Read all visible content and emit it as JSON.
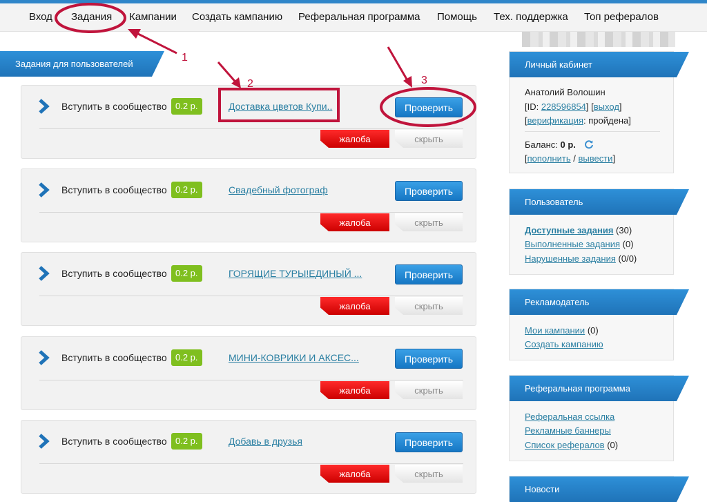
{
  "nav": {
    "items": [
      "Вход",
      "Задания",
      "Кампании",
      "Создать кампанию",
      "Реферальная программа",
      "Помощь",
      "Тех. поддержка",
      "Топ рефералов"
    ]
  },
  "main": {
    "section_title": "Задания для пользователей",
    "tasks": [
      {
        "title": "Вступить в сообщество",
        "price": "0.2 р.",
        "link": "Доставка цветов Купи..",
        "check": "Проверить",
        "complain": "жалоба",
        "hide": "скрыть"
      },
      {
        "title": "Вступить в сообщество",
        "price": "0.2 р.",
        "link": "Свадебный фотограф",
        "check": "Проверить",
        "complain": "жалоба",
        "hide": "скрыть"
      },
      {
        "title": "Вступить в сообщество",
        "price": "0.2 р.",
        "link": "ГОРЯЩИЕ ТУРЫ!ЕДИНЫЙ ...",
        "check": "Проверить",
        "complain": "жалоба",
        "hide": "скрыть"
      },
      {
        "title": "Вступить в сообщество",
        "price": "0.2 р.",
        "link": "МИНИ-КОВРИКИ И АКСЕС...",
        "check": "Проверить",
        "complain": "жалоба",
        "hide": "скрыть"
      },
      {
        "title": "Вступить в сообщество",
        "price": "0.2 р.",
        "link": "Добавь в друзья",
        "check": "Проверить",
        "complain": "жалоба",
        "hide": "скрыть"
      }
    ]
  },
  "sidebar": {
    "cabinet": {
      "title": "Личный кабинет",
      "name": "Анатолий Волошин",
      "id_prefix": "[ID: ",
      "id_value": "228596854",
      "id_mid": "] [",
      "logout": "выход",
      "id_suffix": "]",
      "verif_open": "[",
      "verif_link": "верификация",
      "verif_status": ": пройдена]",
      "balance_label": "Баланс: ",
      "balance_value": "0 р.",
      "br_open": "[",
      "topup": "пополнить",
      "slash": " / ",
      "withdraw": "вывести",
      "br_close": "]"
    },
    "user": {
      "title": "Пользователь",
      "items": [
        {
          "label": "Доступные задания",
          "count": " (30)"
        },
        {
          "label": "Выполненные задания",
          "count": " (0)"
        },
        {
          "label": "Нарушенные задания",
          "count": " (0/0)"
        }
      ]
    },
    "advertiser": {
      "title": "Рекламодатель",
      "items": [
        {
          "label": "Мои кампании",
          "count": " (0)"
        },
        {
          "label": "Создать кампанию",
          "count": ""
        }
      ]
    },
    "referral": {
      "title": "Реферальная программа",
      "items": [
        {
          "label": "Реферальная ссылка",
          "count": ""
        },
        {
          "label": "Рекламные баннеры",
          "count": ""
        },
        {
          "label": "Список рефералов",
          "count": " (0)"
        }
      ]
    },
    "news": {
      "title": "Новости"
    }
  },
  "annotations": [
    "1",
    "2",
    "3"
  ],
  "colors": {
    "accent": "#1f73b8",
    "price": "#7fbf1f",
    "complain": "#e00000",
    "annotation": "#c0143c"
  }
}
